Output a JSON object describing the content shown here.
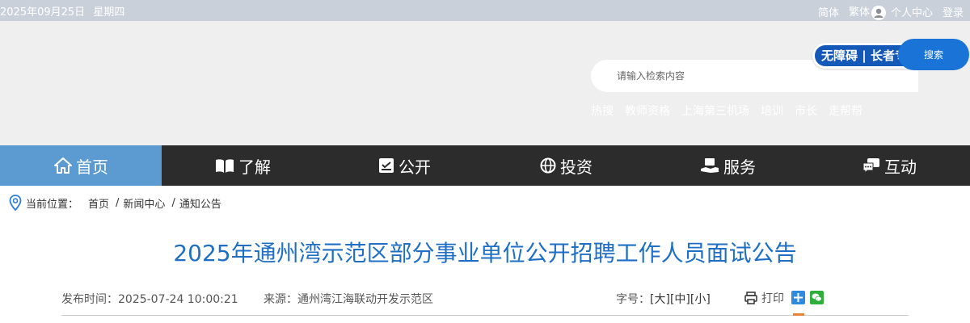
{
  "topbar": {
    "date": "2025年09月25日",
    "weekday": "星期四",
    "simplified": "简体",
    "traditional": "繁体",
    "personal_center": "个人中心",
    "login": "登录"
  },
  "header": {
    "accessibility": "无障碍 | 长者专版",
    "search": {
      "placeholder": "请输入检索内容",
      "button": "搜索"
    },
    "hot_words": [
      "热搜",
      "教师资格",
      "上海第三机场",
      "培训",
      "市长",
      "走帮帮"
    ]
  },
  "nav": [
    {
      "label": "首页",
      "icon": "home-icon",
      "active": true
    },
    {
      "label": "了解",
      "icon": "book-icon"
    },
    {
      "label": "公开",
      "icon": "open-file-icon"
    },
    {
      "label": "投资",
      "icon": "globe-icon"
    },
    {
      "label": "服务",
      "icon": "service-hand-icon"
    },
    {
      "label": "互动",
      "icon": "chat-icon"
    }
  ],
  "breadcrumb": {
    "prefix": "当前位置：",
    "items": [
      "首页",
      "新闻中心",
      "通知公告"
    ]
  },
  "article": {
    "title": "2025年通州湾示范区部分事业单位公开招聘工作人员面试公告",
    "published": "发布时间：2025-07-24 10:00:21",
    "source": "来源：通州湾江海联动开发示范区",
    "font_size_label": "字号：",
    "font_large": "[大]",
    "font_medium": "[中]",
    "font_small": "[小]",
    "print": "打印"
  },
  "colors": {
    "nav_active": "#5b9bd1",
    "nav_bg": "#2c2c2c",
    "title": "#1f6fc4",
    "search_button": "#1a74d8"
  }
}
